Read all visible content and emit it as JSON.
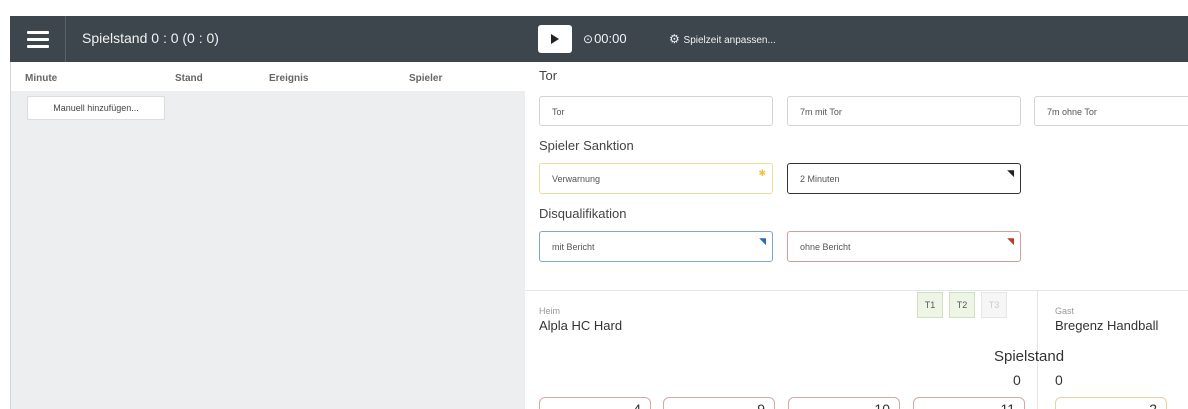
{
  "header": {
    "score_title": "Spielstand 0 : 0 (0 : 0)",
    "timer": "00:00",
    "adjust_label": "Spielzeit anpassen..."
  },
  "event_table": {
    "columns": [
      "Minute",
      "Stand",
      "Ereignis",
      "Spieler"
    ],
    "add_button": "Manuell hinzufügen..."
  },
  "sections": {
    "goal": {
      "title": "Tor",
      "buttons": [
        "Tor",
        "7m mit Tor",
        "7m ohne Tor"
      ]
    },
    "sanction": {
      "title": "Spieler Sanktion",
      "buttons": [
        "Verwarnung",
        "2 Minuten"
      ],
      "colors": [
        "#f0c23a",
        "#222222"
      ]
    },
    "disqualification": {
      "title": "Disqualifikation",
      "buttons": [
        "mit Bericht",
        "ohne Bericht"
      ],
      "colors": [
        "#2b6cb0",
        "#c0392b"
      ]
    }
  },
  "teams": {
    "home": {
      "caption": "Heim",
      "name": "Alpla HC Hard"
    },
    "guest": {
      "caption": "Gast",
      "name": "Bregenz Handball"
    },
    "timeouts": [
      "T1",
      "T2",
      "T3"
    ],
    "score_label": "Spielstand",
    "home_score": "0",
    "guest_score": "0",
    "home_players": [
      "4",
      "9",
      "10",
      "11"
    ],
    "guest_players": [
      "2"
    ]
  },
  "icons": {
    "menu": "hamburger-icon",
    "play": "play-icon",
    "timer": "clock-icon",
    "adjust": "gear-icon"
  }
}
